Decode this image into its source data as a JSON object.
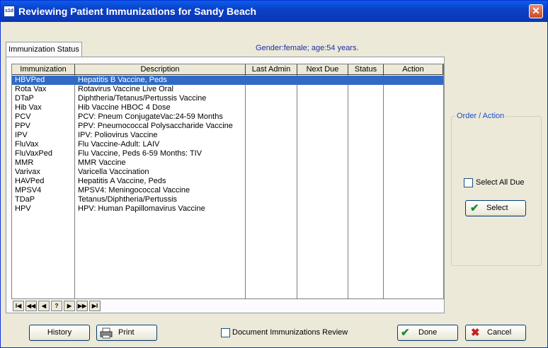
{
  "window": {
    "title": "Reviewing Patient Immunizations for Sandy Beach",
    "icon_text": "s1d"
  },
  "tab": {
    "label": "Immunization Status"
  },
  "patient_info": "Gender:female; age:54 years.",
  "grid": {
    "columns": [
      "Immunization",
      "Description",
      "Last Admin",
      "Next Due",
      "Status",
      "Action"
    ],
    "rows": [
      {
        "immunization": "HBVPed",
        "description": "Hepatitis B Vaccine, Peds",
        "selected": true
      },
      {
        "immunization": "Rota Vax",
        "description": "Rotavirus Vaccine Live Oral"
      },
      {
        "immunization": "DTaP",
        "description": "Diphtheria/Tetanus/Pertussis Vaccine"
      },
      {
        "immunization": "Hib Vax",
        "description": "Hib Vaccine HBOC 4 Dose"
      },
      {
        "immunization": "PCV",
        "description": "PCV: Pneum ConjugateVac:24-59 Months"
      },
      {
        "immunization": "PPV",
        "description": "PPV: Pneumococcal Polysaccharide Vaccine"
      },
      {
        "immunization": "IPV",
        "description": "IPV: Poliovirus Vaccine"
      },
      {
        "immunization": "FluVax",
        "description": "Flu Vaccine-Adult: LAIV"
      },
      {
        "immunization": "FluVaxPed",
        "description": "Flu Vaccine, Peds 6-59 Months: TIV"
      },
      {
        "immunization": "MMR",
        "description": "MMR Vaccine"
      },
      {
        "immunization": "Varivax",
        "description": "Varicella Vaccination"
      },
      {
        "immunization": "HAVPed",
        "description": "Hepatitis A Vaccine, Peds"
      },
      {
        "immunization": "MPSV4",
        "description": "MPSV4: Meningococcal Vaccine"
      },
      {
        "immunization": "TDaP",
        "description": "Tetanus/Diphtheria/Pertussis"
      },
      {
        "immunization": "HPV",
        "description": "HPV: Human Papillomavirus Vaccine"
      }
    ]
  },
  "navigator": {
    "first": "I◀",
    "prev_page": "◀◀",
    "prev": "◀",
    "help": "?",
    "next": "▶",
    "next_page": "▶▶",
    "last": "▶I"
  },
  "order_action": {
    "title": "Order / Action",
    "select_all_due_label": "Select All Due",
    "select_all_due_checked": false,
    "select_button": "Select"
  },
  "footer": {
    "history_button": "History",
    "print_button": "Print",
    "document_review_label": "Document Immunizations Review",
    "document_review_checked": false,
    "done_button": "Done",
    "cancel_button": "Cancel"
  },
  "colors": {
    "selection": "#316ac5",
    "title_bar": "#0a46c8",
    "accent_text": "#1a4fc8"
  },
  "icons": {
    "close": "close-icon",
    "print": "printer-icon",
    "done": "checkmark-icon",
    "cancel": "x-icon",
    "select": "checkmark-icon"
  }
}
